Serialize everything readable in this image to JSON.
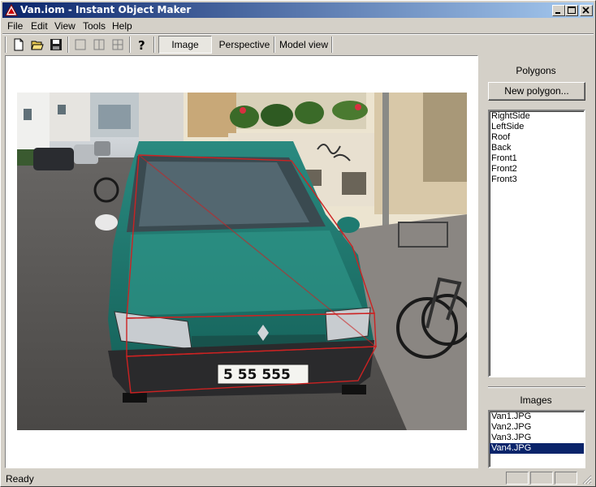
{
  "window": {
    "title": "Van.iom - Instant Object Maker"
  },
  "menu": [
    "File",
    "Edit",
    "View",
    "Tools",
    "Help"
  ],
  "toolbar": {
    "icons": [
      "new-file-icon",
      "open-folder-icon",
      "save-disk-icon",
      "view-single-icon",
      "view-split-icon",
      "view-grid-icon",
      "help-icon"
    ],
    "view_tabs": [
      "Image",
      "Perspective",
      "Model view"
    ],
    "active_view": "Image"
  },
  "polygons_panel": {
    "title": "Polygons",
    "new_button": "New polygon...",
    "items": [
      "RightSide",
      "LeftSide",
      "Roof",
      "Back",
      "Front1",
      "Front2",
      "Front3"
    ]
  },
  "images_panel": {
    "title": "Images",
    "items": [
      "Van1.JPG",
      "Van2.JPG",
      "Van3.JPG",
      "Van4.JPG"
    ],
    "selected": "Van4.JPG"
  },
  "photo": {
    "plate": "5 55 555",
    "overlay_color": "#cc2222"
  },
  "status": {
    "text": "Ready"
  }
}
